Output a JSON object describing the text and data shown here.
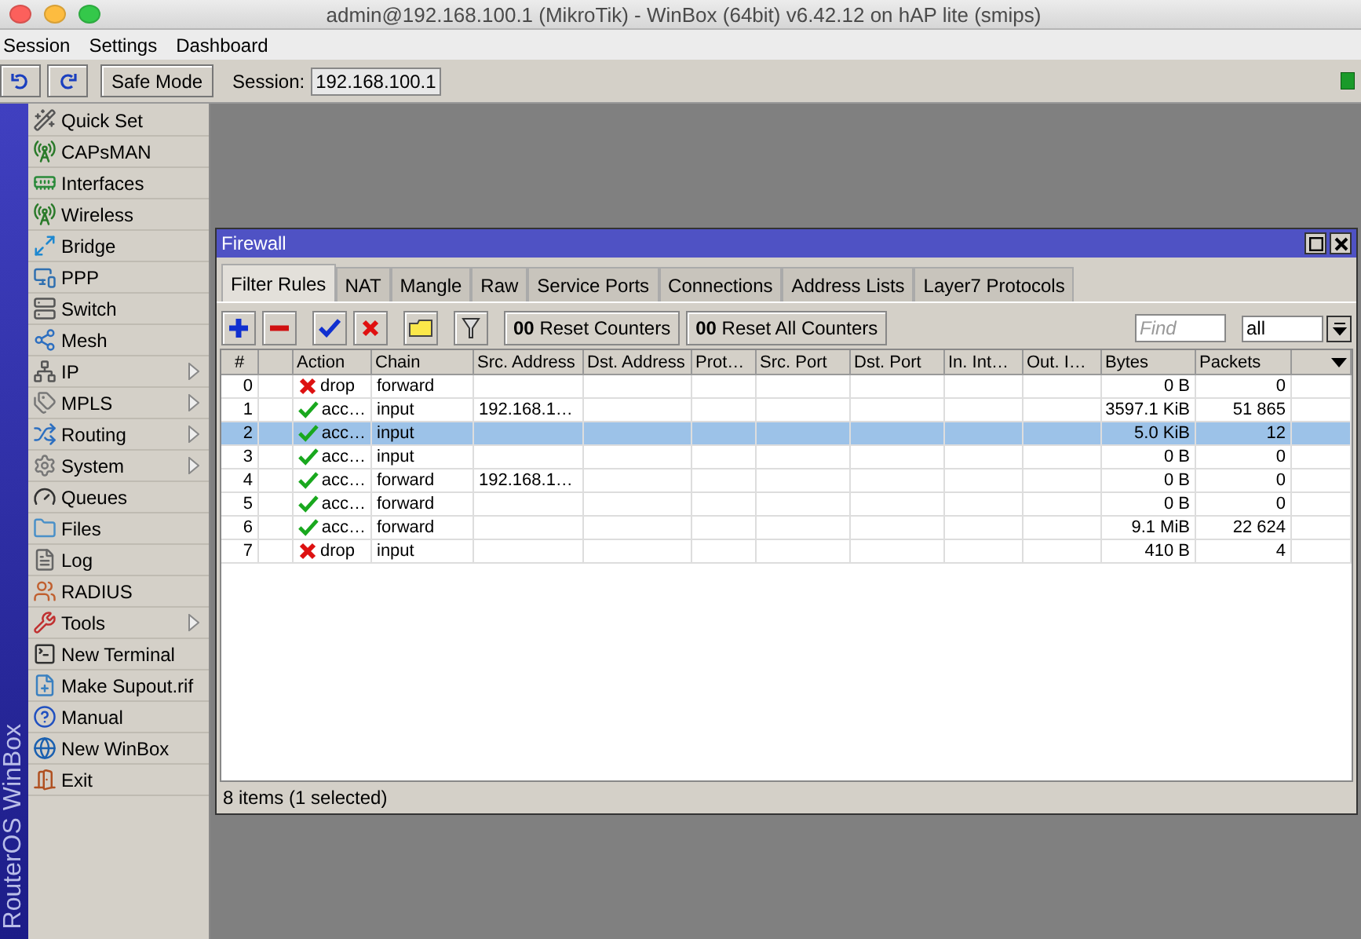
{
  "window": {
    "title": "admin@192.168.100.1 (MikroTik) - WinBox (64bit) v6.42.12 on hAP lite (smips)"
  },
  "menu": [
    "Session",
    "Settings",
    "Dashboard"
  ],
  "toolbar": {
    "safe_mode": "Safe Mode",
    "session_label": "Session:",
    "session_value": "192.168.100.1"
  },
  "brand": "RouterOS WinBox",
  "sidebar": {
    "items": [
      {
        "label": "Quick Set",
        "submenu": false
      },
      {
        "label": "CAPsMAN",
        "submenu": false
      },
      {
        "label": "Interfaces",
        "submenu": false
      },
      {
        "label": "Wireless",
        "submenu": false
      },
      {
        "label": "Bridge",
        "submenu": false
      },
      {
        "label": "PPP",
        "submenu": false
      },
      {
        "label": "Switch",
        "submenu": false
      },
      {
        "label": "Mesh",
        "submenu": false
      },
      {
        "label": "IP",
        "submenu": true
      },
      {
        "label": "MPLS",
        "submenu": true
      },
      {
        "label": "Routing",
        "submenu": true
      },
      {
        "label": "System",
        "submenu": true
      },
      {
        "label": "Queues",
        "submenu": false
      },
      {
        "label": "Files",
        "submenu": false
      },
      {
        "label": "Log",
        "submenu": false
      },
      {
        "label": "RADIUS",
        "submenu": false
      },
      {
        "label": "Tools",
        "submenu": true
      },
      {
        "label": "New Terminal",
        "submenu": false
      },
      {
        "label": "Make Supout.rif",
        "submenu": false
      },
      {
        "label": "Manual",
        "submenu": false
      },
      {
        "label": "New WinBox",
        "submenu": false
      },
      {
        "label": "Exit",
        "submenu": false
      }
    ]
  },
  "firewall": {
    "title": "Firewall",
    "tabs": [
      {
        "label": "Filter Rules",
        "selected": true
      },
      {
        "label": "NAT",
        "selected": false
      },
      {
        "label": "Mangle",
        "selected": false
      },
      {
        "label": "Raw",
        "selected": false
      },
      {
        "label": "Service Ports",
        "selected": false
      },
      {
        "label": "Connections",
        "selected": false
      },
      {
        "label": "Address Lists",
        "selected": false
      },
      {
        "label": "Layer7 Protocols",
        "selected": false
      }
    ],
    "buttons": [
      "**00** Reset Counters",
      "**00** Reset All Counters"
    ],
    "find": {
      "placeholder": "Find"
    },
    "filter": {
      "value": "all"
    },
    "table": {
      "columns": [
        "#",
        "Action",
        "Chain",
        "Src. Address",
        "Dst. Address",
        "Prot…",
        "Src. Port",
        "Dst. Port",
        "In. Int…",
        "Out. I…",
        "Bytes",
        "Packets"
      ],
      "rows": [
        {
          "number": "0",
          "kind": "drop",
          "action": "drop",
          "chain": "forward",
          "src_address": "",
          "bytes": "0 B",
          "packets": "0",
          "selected": false
        },
        {
          "number": "1",
          "kind": "accept",
          "action": "acc…",
          "chain": "input",
          "src_address": "192.168.1…",
          "bytes": "3597.1 KiB",
          "packets": "51 865",
          "selected": false
        },
        {
          "number": "2",
          "kind": "accept",
          "action": "acc…",
          "chain": "input",
          "src_address": "",
          "bytes": "5.0 KiB",
          "packets": "12",
          "selected": true
        },
        {
          "number": "3",
          "kind": "accept",
          "action": "acc…",
          "chain": "input",
          "src_address": "",
          "bytes": "0 B",
          "packets": "0",
          "selected": false
        },
        {
          "number": "4",
          "kind": "accept",
          "action": "acc…",
          "chain": "forward",
          "src_address": "192.168.1…",
          "bytes": "0 B",
          "packets": "0",
          "selected": false
        },
        {
          "number": "5",
          "kind": "accept",
          "action": "acc…",
          "chain": "forward",
          "src_address": "",
          "bytes": "0 B",
          "packets": "0",
          "selected": false
        },
        {
          "number": "6",
          "kind": "accept",
          "action": "acc…",
          "chain": "forward",
          "src_address": "",
          "bytes": "9.1 MiB",
          "packets": "22 624",
          "selected": false
        },
        {
          "number": "7",
          "kind": "drop",
          "action": "drop",
          "chain": "input",
          "src_address": "",
          "bytes": "410 B",
          "packets": "4",
          "selected": false
        }
      ]
    },
    "status": "8 items (1 selected)"
  }
}
